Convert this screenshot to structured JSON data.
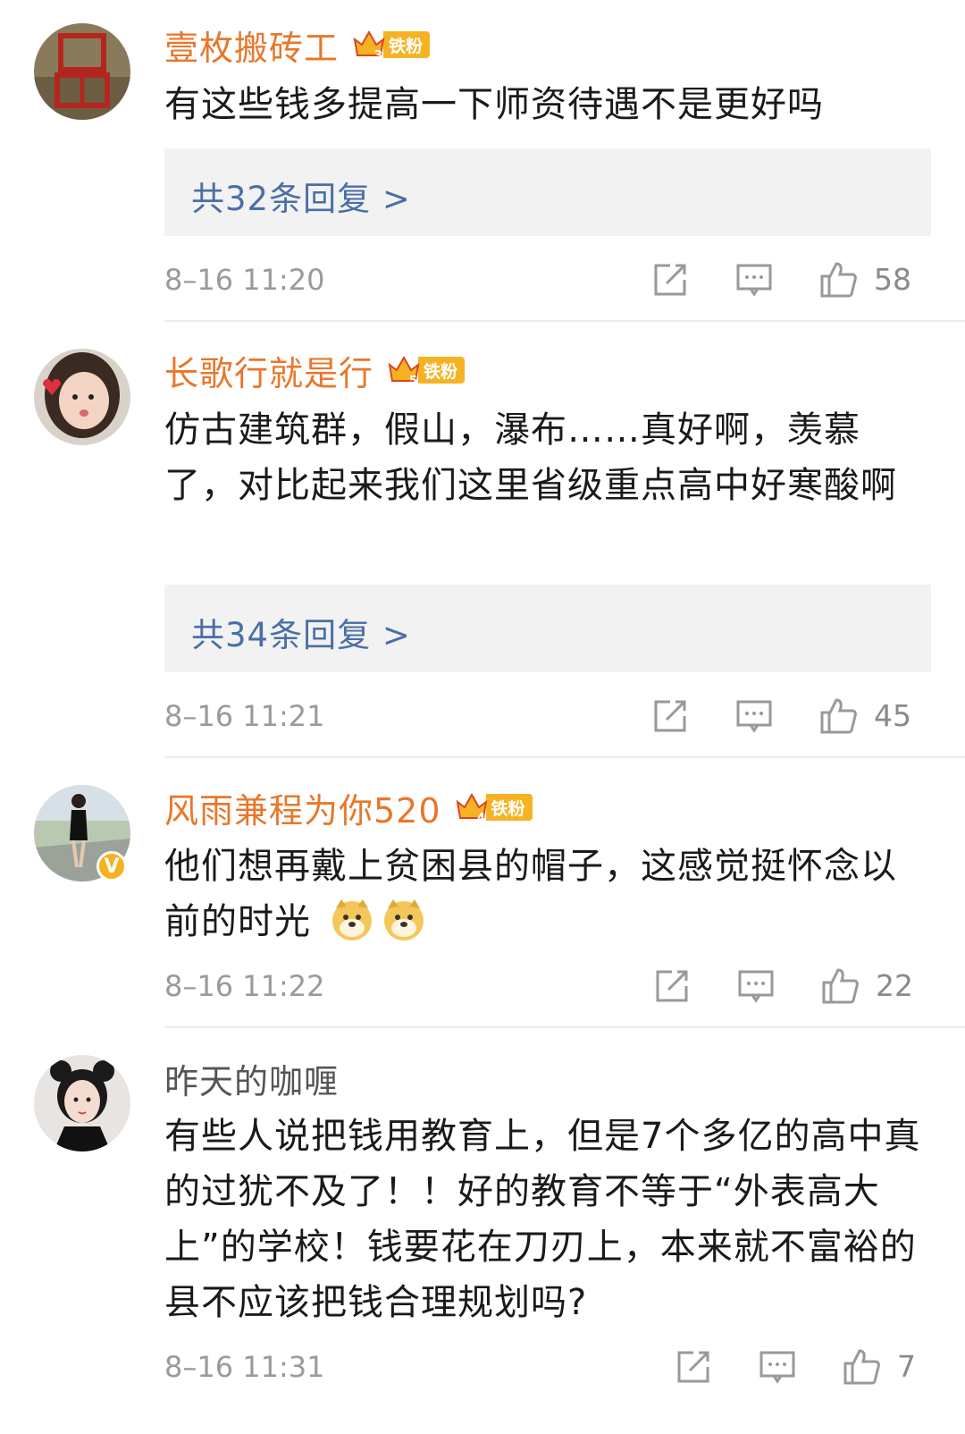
{
  "comments": [
    {
      "username": "壹枚搬砖工",
      "fan_badge": "铁粉",
      "fan_level": "3",
      "text": "有这些钱多提高一下师资待遇不是更好吗",
      "replies": "共32条回复 >",
      "time": "8–16 11:20",
      "likes": "58"
    },
    {
      "username": "长歌行就是行",
      "fan_badge": "铁粉",
      "fan_level": "5",
      "text": "仿古建筑群，假山，瀑布……真好啊，羡慕了，对比起来我们这里省级重点高中好寒酸啊",
      "replies": "共34条回复 >",
      "time": "8–16 11:21",
      "likes": "45"
    },
    {
      "username": "风雨兼程为你520",
      "fan_badge": "铁粉",
      "fan_level": "4",
      "verified": "V",
      "text": "他们想再戴上贫困县的帽子，这感觉挺怀念以前的时光",
      "time": "8–16 11:22",
      "likes": "22"
    },
    {
      "username": "昨天的咖喱",
      "text": "有些人说把钱用教育上，但是7个多亿的高中真的过犹不及了！！好的教育不等于“外表高大上”的学校！钱要花在刀刃上，本来就不富裕的县不应该把钱合理规划吗?",
      "time": "8–16 11:31",
      "likes": "7"
    }
  ],
  "icons": {
    "share": "share-icon",
    "comment": "comment-icon",
    "like": "thumbs-up-icon",
    "emoji": "doge-emoji-icon"
  },
  "colors": {
    "username": "#e8772a",
    "reply_link": "#4a6fa5",
    "fan_badge": "#f5b324",
    "meta": "#9a9a9a"
  }
}
